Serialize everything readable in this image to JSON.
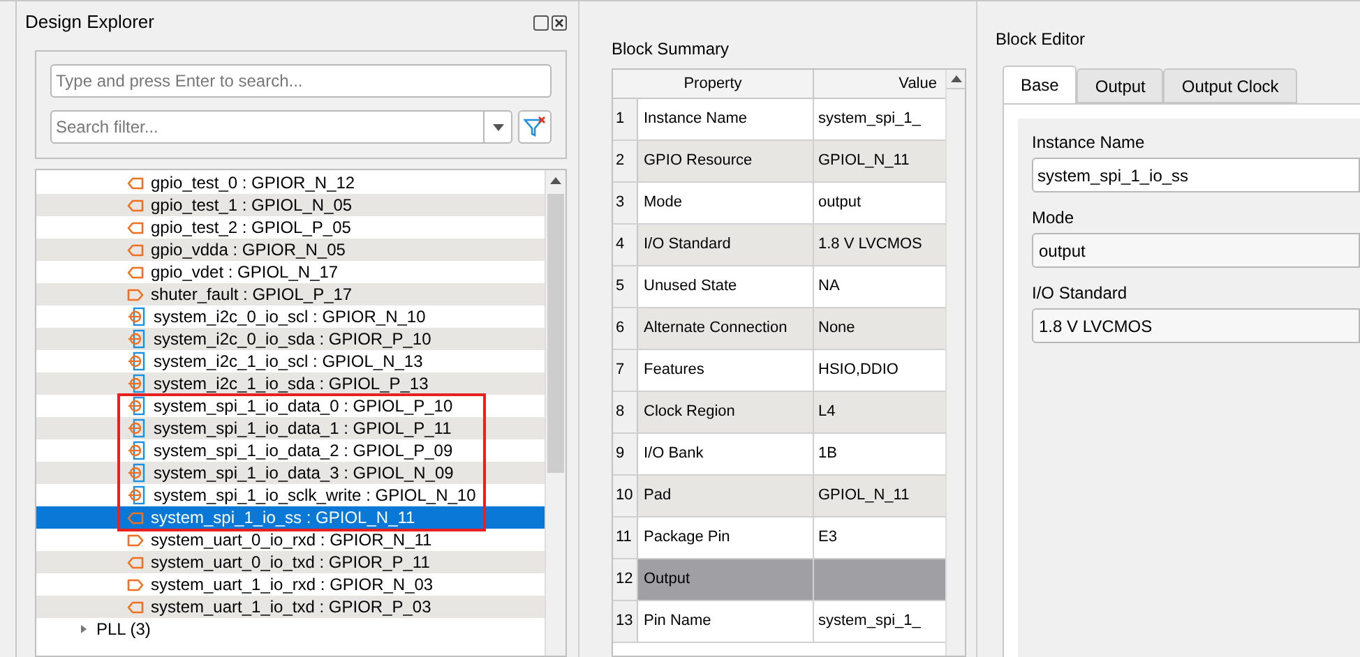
{
  "design_explorer": {
    "title": "Design Explorer",
    "search": {
      "placeholder": "Type and press Enter to search..."
    },
    "filter": {
      "placeholder": "Search filter..."
    },
    "tree": [
      {
        "label": "gpio_test_0 : GPIOR_N_12",
        "kind": "out",
        "selected": false,
        "annotated": false
      },
      {
        "label": "gpio_test_1 : GPIOL_N_05",
        "kind": "out",
        "selected": false,
        "annotated": false
      },
      {
        "label": "gpio_test_2 : GPIOL_P_05",
        "kind": "out",
        "selected": false,
        "annotated": false
      },
      {
        "label": "gpio_vdda : GPIOR_N_05",
        "kind": "out",
        "selected": false,
        "annotated": false
      },
      {
        "label": "gpio_vdet : GPIOL_N_17",
        "kind": "out",
        "selected": false,
        "annotated": false
      },
      {
        "label": "shuter_fault : GPIOL_P_17",
        "kind": "in",
        "selected": false,
        "annotated": false
      },
      {
        "label": "system_i2c_0_io_scl : GPIOR_N_10",
        "kind": "inout",
        "selected": false,
        "annotated": false
      },
      {
        "label": "system_i2c_0_io_sda : GPIOR_P_10",
        "kind": "inout",
        "selected": false,
        "annotated": false
      },
      {
        "label": "system_i2c_1_io_scl : GPIOL_N_13",
        "kind": "inout",
        "selected": false,
        "annotated": false
      },
      {
        "label": "system_i2c_1_io_sda : GPIOL_P_13",
        "kind": "inout",
        "selected": false,
        "annotated": false
      },
      {
        "label": "system_spi_1_io_data_0 : GPIOL_P_10",
        "kind": "inout",
        "selected": false,
        "annotated": true
      },
      {
        "label": "system_spi_1_io_data_1 : GPIOL_P_11",
        "kind": "inout",
        "selected": false,
        "annotated": true
      },
      {
        "label": "system_spi_1_io_data_2 : GPIOL_P_09",
        "kind": "inout",
        "selected": false,
        "annotated": true
      },
      {
        "label": "system_spi_1_io_data_3 : GPIOL_N_09",
        "kind": "inout",
        "selected": false,
        "annotated": true
      },
      {
        "label": "system_spi_1_io_sclk_write : GPIOL_N_10",
        "kind": "inout",
        "selected": false,
        "annotated": true
      },
      {
        "label": "system_spi_1_io_ss : GPIOL_N_11",
        "kind": "out",
        "selected": true,
        "annotated": true
      },
      {
        "label": "system_uart_0_io_rxd : GPIOR_N_11",
        "kind": "in",
        "selected": false,
        "annotated": false
      },
      {
        "label": "system_uart_0_io_txd : GPIOR_P_11",
        "kind": "out",
        "selected": false,
        "annotated": false
      },
      {
        "label": "system_uart_1_io_rxd : GPIOR_N_03",
        "kind": "in",
        "selected": false,
        "annotated": false
      },
      {
        "label": "system_uart_1_io_txd : GPIOR_P_03",
        "kind": "out",
        "selected": false,
        "annotated": false
      },
      {
        "label": "PLL (3)",
        "kind": "group",
        "selected": false,
        "annotated": false
      }
    ]
  },
  "block_summary": {
    "title": "Block Summary",
    "columns": [
      "Property",
      "Value"
    ],
    "rows": [
      {
        "index": "1",
        "property": "Instance Name",
        "value": "system_spi_1_",
        "kind": "field"
      },
      {
        "index": "2",
        "property": "GPIO Resource",
        "value": "GPIOL_N_11",
        "kind": "field"
      },
      {
        "index": "3",
        "property": "Mode",
        "value": "output",
        "kind": "field"
      },
      {
        "index": "4",
        "property": "I/O Standard",
        "value": "1.8 V LVCMOS",
        "kind": "field"
      },
      {
        "index": "5",
        "property": "Unused State",
        "value": "NA",
        "kind": "field"
      },
      {
        "index": "6",
        "property": "Alternate Connection",
        "value": "None",
        "kind": "field"
      },
      {
        "index": "7",
        "property": "Features",
        "value": "HSIO,DDIO",
        "kind": "field"
      },
      {
        "index": "8",
        "property": "Clock Region",
        "value": "L4",
        "kind": "field"
      },
      {
        "index": "9",
        "property": "I/O Bank",
        "value": "1B",
        "kind": "field"
      },
      {
        "index": "10",
        "property": "Pad",
        "value": "GPIOL_N_11",
        "kind": "field"
      },
      {
        "index": "11",
        "property": "Package Pin",
        "value": "E3",
        "kind": "field"
      },
      {
        "index": "12",
        "property": "Output",
        "kind": "section"
      },
      {
        "index": "13",
        "property": "Pin Name",
        "value": "system_spi_1_",
        "kind": "field"
      }
    ]
  },
  "block_editor": {
    "title": "Block Editor",
    "tabs": [
      {
        "label": "Base",
        "selected": true
      },
      {
        "label": "Output",
        "selected": false
      },
      {
        "label": "Output Clock",
        "selected": false
      }
    ],
    "fields": [
      {
        "label": "Instance Name",
        "value": "system_spi_1_io_ss",
        "kind": "text"
      },
      {
        "label": "Mode",
        "value": "output",
        "kind": "select"
      },
      {
        "label": "I/O Standard",
        "value": "1.8 V LVCMOS",
        "kind": "select"
      }
    ]
  }
}
